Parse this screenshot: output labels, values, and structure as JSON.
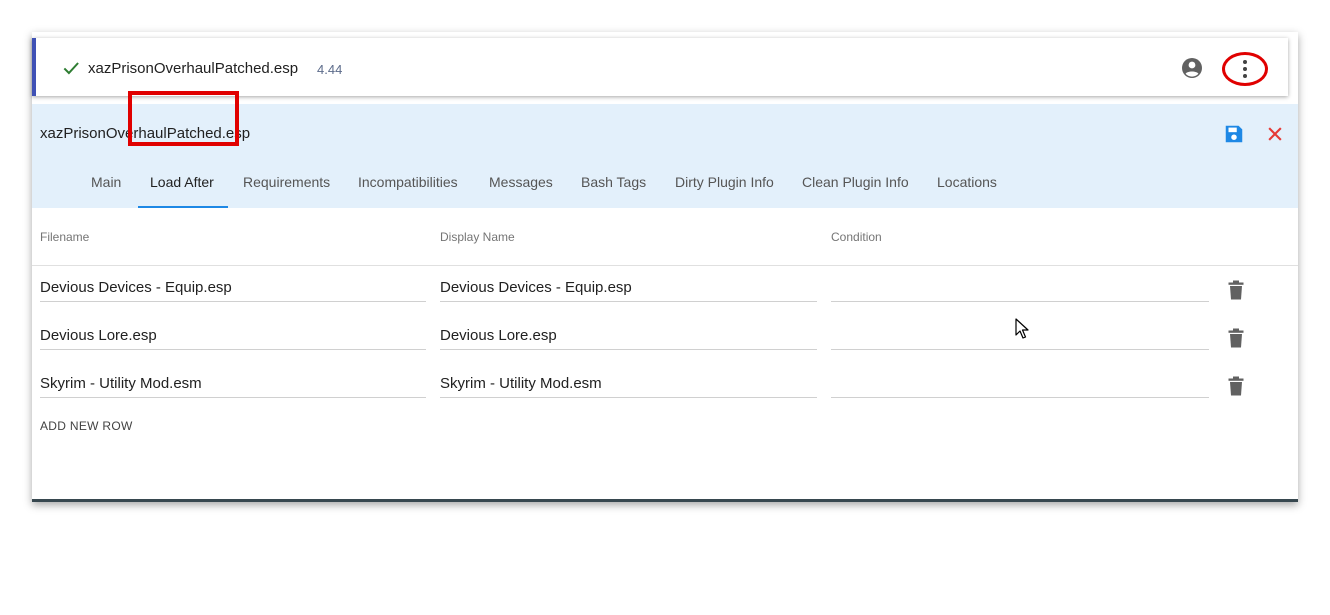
{
  "plugin": {
    "name": "xazPrisonOverhaulPatched.esp",
    "version": "4.44"
  },
  "editor": {
    "title": "xazPrisonOverhaulPatched.esp"
  },
  "tabs": [
    {
      "label": "Main"
    },
    {
      "label": "Load After"
    },
    {
      "label": "Requirements"
    },
    {
      "label": "Incompatibilities"
    },
    {
      "label": "Messages"
    },
    {
      "label": "Bash Tags"
    },
    {
      "label": "Dirty Plugin Info"
    },
    {
      "label": "Clean Plugin Info"
    },
    {
      "label": "Locations"
    }
  ],
  "active_tab": "Load After",
  "table": {
    "headers": [
      "Filename",
      "Display Name",
      "Condition"
    ],
    "rows": [
      {
        "filename": "Devious Devices - Equip.esp",
        "display_name": "Devious Devices - Equip.esp",
        "condition": ""
      },
      {
        "filename": "Devious Lore.esp",
        "display_name": "Devious Lore.esp",
        "condition": ""
      },
      {
        "filename": "Skyrim - Utility Mod.esm",
        "display_name": "Skyrim - Utility Mod.esm",
        "condition": ""
      }
    ],
    "add_label": "ADD NEW ROW"
  },
  "icons": {
    "check": "check-icon",
    "account": "account-circle-icon",
    "menu": "more-vert-icon",
    "save": "save-icon",
    "close": "close-icon",
    "delete": "trash-icon",
    "cursor": "mouse-cursor-icon"
  },
  "colors": {
    "check": "#2e7d32",
    "accent": "#1e88e5",
    "close": "#e53935",
    "annotation": "#e00000",
    "editor_bg": "#e3f0fb",
    "card_border": "#3f51b5"
  }
}
